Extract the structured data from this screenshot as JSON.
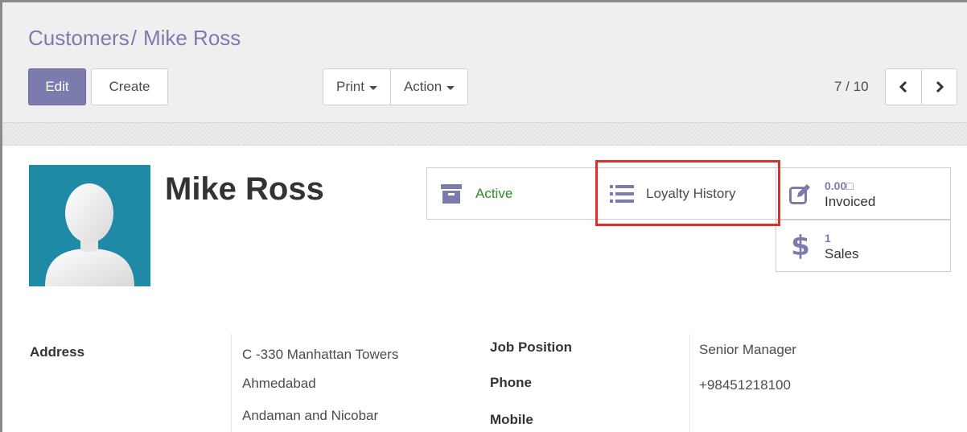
{
  "breadcrumb": {
    "parent": "Customers",
    "separator": "/",
    "current": "Mike Ross"
  },
  "toolbar": {
    "edit_label": "Edit",
    "create_label": "Create",
    "print_label": "Print",
    "action_label": "Action"
  },
  "pager": {
    "value": "7 / 10"
  },
  "partner": {
    "name": "Mike Ross"
  },
  "smart_buttons": {
    "active": {
      "label": "Active",
      "icon": "archive-icon"
    },
    "loyalty": {
      "label": "Loyalty History",
      "icon": "list-icon"
    },
    "invoiced": {
      "value": "0.00□",
      "label": "Invoiced",
      "icon": "pencil-square-icon"
    },
    "sales": {
      "value": "1",
      "label": "Sales",
      "icon": "dollar-icon"
    }
  },
  "fields": {
    "address_label": "Address",
    "address_lines": [
      "C -330 Manhattan Towers",
      "Ahmedabad",
      "Andaman and Nicobar"
    ],
    "job_position_label": "Job Position",
    "job_position_value": "Senior Manager",
    "phone_label": "Phone",
    "phone_value": "+98451218100",
    "mobile_label": "Mobile"
  },
  "colors": {
    "brand": "#7c7bad",
    "active_green": "#2d8a2d",
    "highlight_red": "#d9312b",
    "avatar_bg": "#1f8aa5"
  }
}
